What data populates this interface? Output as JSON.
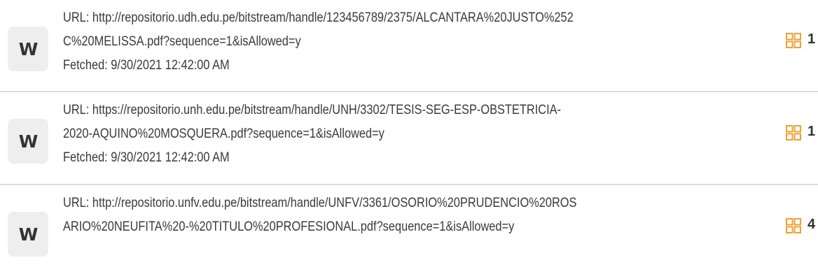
{
  "results": [
    {
      "source_letter": "W",
      "url_lines": [
        "URL: http://repositorio.udh.edu.pe/bitstream/handle/123456789/2375/ALCANTARA%20JUSTO%252",
        "C%20MELISSA.pdf?sequence=1&isAllowed=y"
      ],
      "fetched": "Fetched: 9/30/2021 12:42:00 AM",
      "match_count": "1",
      "icon": "grid-icon"
    },
    {
      "source_letter": "W",
      "url_lines": [
        "URL: https://repositorio.unh.edu.pe/bitstream/handle/UNH/3302/TESIS-SEG-ESP-OBSTETRICIA-",
        "2020-AQUINO%20MOSQUERA.pdf?sequence=1&isAllowed=y"
      ],
      "fetched": "Fetched: 9/30/2021 12:42:00 AM",
      "match_count": "1",
      "icon": "grid-icon"
    },
    {
      "source_letter": "W",
      "url_lines": [
        "URL: http://repositorio.unfv.edu.pe/bitstream/handle/UNFV/3361/OSORIO%20PRUDENCIO%20ROS",
        "ARIO%20NEUFITA%20-%20TITULO%20PROFESIONAL.pdf?sequence=1&isAllowed=y"
      ],
      "fetched": "",
      "match_count": "4",
      "icon": "grid-icon"
    }
  ],
  "colors": {
    "accent": "#f0a030",
    "badge_bg": "#eeeeee",
    "text": "#3a3a3a",
    "divider": "#dcdcdc"
  }
}
